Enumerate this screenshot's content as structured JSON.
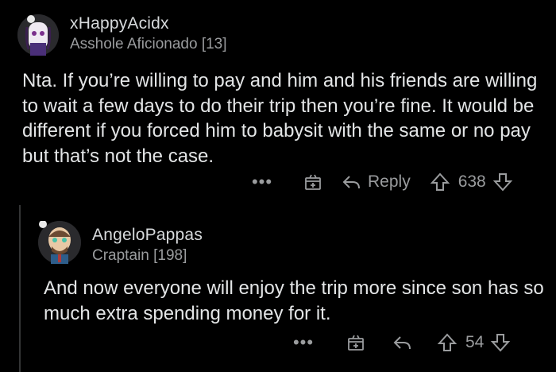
{
  "comments": [
    {
      "username": "xHappyAcidx",
      "flair": "Asshole Aficionado [13]",
      "body": "Nta. If you’re willing to pay and him and his friends are willing to wait a few days to do their trip then you’re fine. It would be different if you forced him to babysit with the same or no pay but that’s not the case.",
      "actions": {
        "more": "•••",
        "reply_label": "Reply",
        "score": "638"
      }
    },
    {
      "username": "AngeloPappas",
      "flair": "Craptain [198]",
      "body": "And now everyone will enjoy the trip more since son has so much extra spending money for it.",
      "actions": {
        "more": "•••",
        "score": "54"
      }
    }
  ],
  "icons": {
    "more": "more-options-icon",
    "award": "award-gift-icon",
    "reply": "reply-arrow-icon",
    "upvote": "upvote-icon",
    "downvote": "downvote-icon"
  },
  "colors": {
    "background": "#000000",
    "text": "#e3e5e6",
    "muted": "#9a9c9e",
    "thread": "#343536"
  }
}
